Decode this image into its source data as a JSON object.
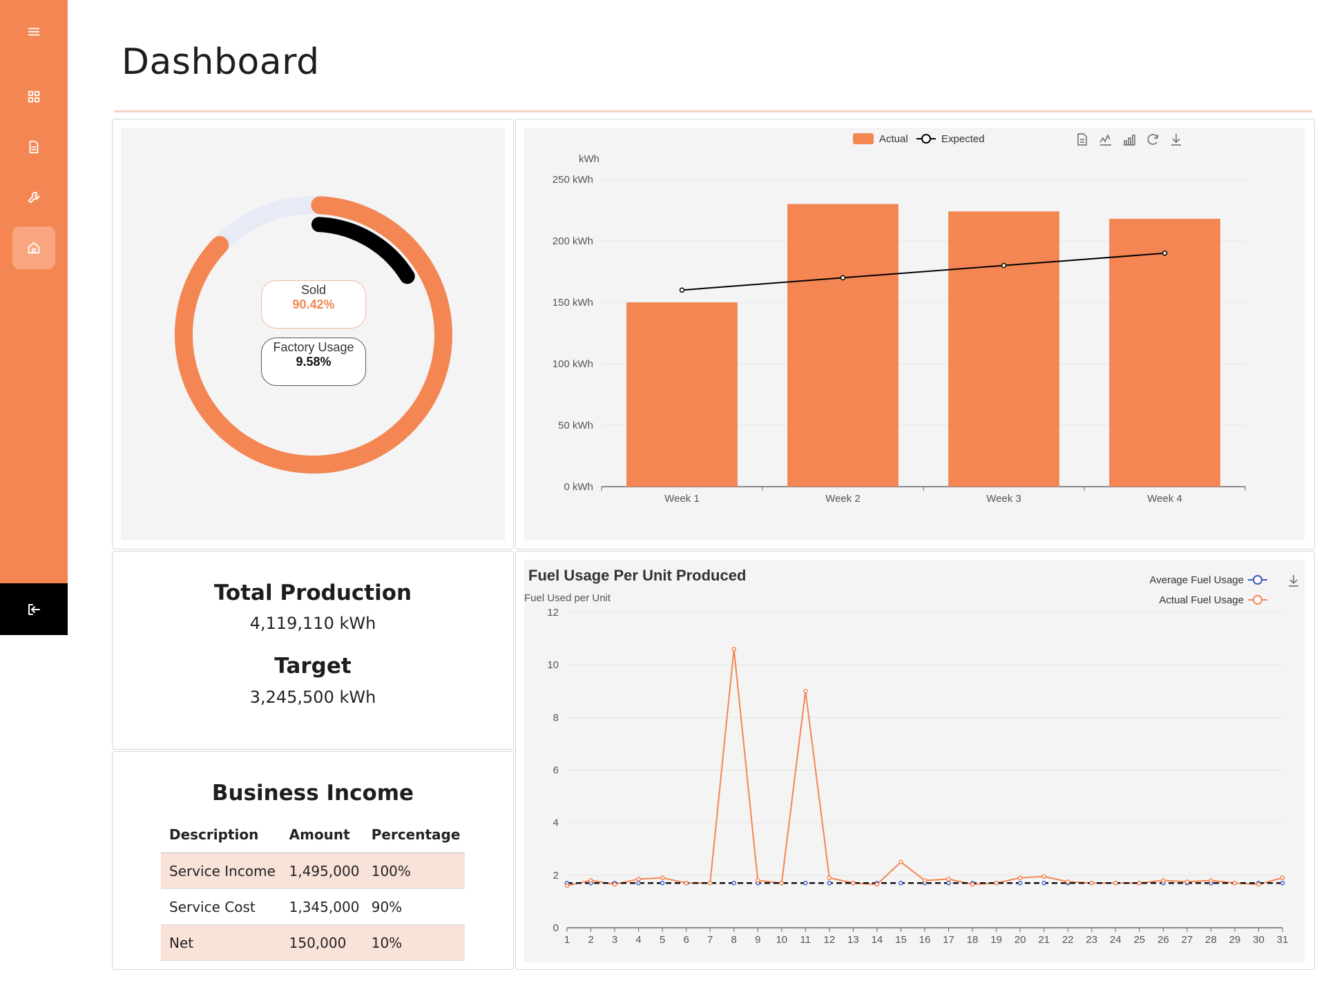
{
  "page": {
    "title": "Dashboard"
  },
  "sidebar": {
    "items": [
      {
        "name": "menu-icon"
      },
      {
        "name": "grid-icon"
      },
      {
        "name": "document-icon"
      },
      {
        "name": "wrench-icon"
      },
      {
        "name": "home-icon",
        "active": true
      }
    ],
    "logout": "logout-icon"
  },
  "donut": {
    "sold_label": "Sold",
    "sold_value": "90.42%",
    "factory_label": "Factory Usage",
    "factory_value": "9.58%",
    "sold_fraction": 0.9042,
    "factory_fraction": 0.0958,
    "colors": {
      "sold": "#f38653",
      "factory": "#000000",
      "track": "#e6ebf6"
    }
  },
  "production": {
    "total_label": "Total Production",
    "total_value": "4,119,110 kWh",
    "target_label": "Target",
    "target_value": "3,245,500 kWh"
  },
  "business_income": {
    "title": "Business Income",
    "headers": [
      "Description",
      "Amount",
      "Percentage"
    ],
    "rows": [
      [
        "Service Income",
        "1,495,000",
        "100%"
      ],
      [
        "Service Cost",
        "1,345,000",
        "90%"
      ],
      [
        "Net",
        "150,000",
        "10%"
      ]
    ]
  },
  "chart_data": [
    {
      "type": "bar",
      "title": "",
      "ylabel": "kWh",
      "categories": [
        "Week 1",
        "Week 2",
        "Week 3",
        "Week 4"
      ],
      "series": [
        {
          "name": "Actual",
          "type": "bar",
          "values": [
            150,
            230,
            224,
            218
          ],
          "color": "#f38653"
        },
        {
          "name": "Expected",
          "type": "line",
          "values": [
            160,
            170,
            180,
            190
          ],
          "color": "#000000"
        }
      ],
      "ylim": [
        0,
        250
      ],
      "yticks": [
        "0 kWh",
        "50 kWh",
        "100 kWh",
        "150 kWh",
        "200 kWh",
        "250 kWh"
      ],
      "legend": "top-center",
      "toolbox": [
        "data-view-icon",
        "line-chart-icon",
        "bar-chart-icon",
        "restore-icon",
        "download-icon"
      ]
    },
    {
      "type": "line",
      "title": "Fuel Usage Per Unit Produced",
      "ylabel": "Fuel Used per Unit",
      "x": [
        1,
        2,
        3,
        4,
        5,
        6,
        7,
        8,
        9,
        10,
        11,
        12,
        13,
        14,
        15,
        16,
        17,
        18,
        19,
        20,
        21,
        22,
        23,
        24,
        25,
        26,
        27,
        28,
        29,
        30,
        31
      ],
      "series": [
        {
          "name": "Average Fuel Usage",
          "color": "#3b5bc4",
          "dashed": true,
          "values": [
            1.7,
            1.7,
            1.7,
            1.7,
            1.7,
            1.7,
            1.7,
            1.7,
            1.7,
            1.7,
            1.7,
            1.7,
            1.7,
            1.7,
            1.7,
            1.7,
            1.7,
            1.7,
            1.7,
            1.7,
            1.7,
            1.7,
            1.7,
            1.7,
            1.7,
            1.7,
            1.7,
            1.7,
            1.7,
            1.7,
            1.7
          ]
        },
        {
          "name": "Actual Fuel Usage",
          "color": "#f38653",
          "values": [
            1.6,
            1.8,
            1.65,
            1.85,
            1.9,
            1.7,
            1.7,
            10.6,
            1.8,
            1.7,
            9.0,
            1.9,
            1.7,
            1.65,
            2.5,
            1.8,
            1.85,
            1.65,
            1.7,
            1.9,
            1.95,
            1.75,
            1.7,
            1.7,
            1.7,
            1.8,
            1.75,
            1.8,
            1.7,
            1.65,
            1.9
          ]
        }
      ],
      "ylim": [
        0,
        12
      ],
      "yticks": [
        0,
        2,
        4,
        6,
        8,
        10,
        12
      ],
      "legend": "top-right",
      "toolbox": [
        "download-icon"
      ]
    }
  ]
}
